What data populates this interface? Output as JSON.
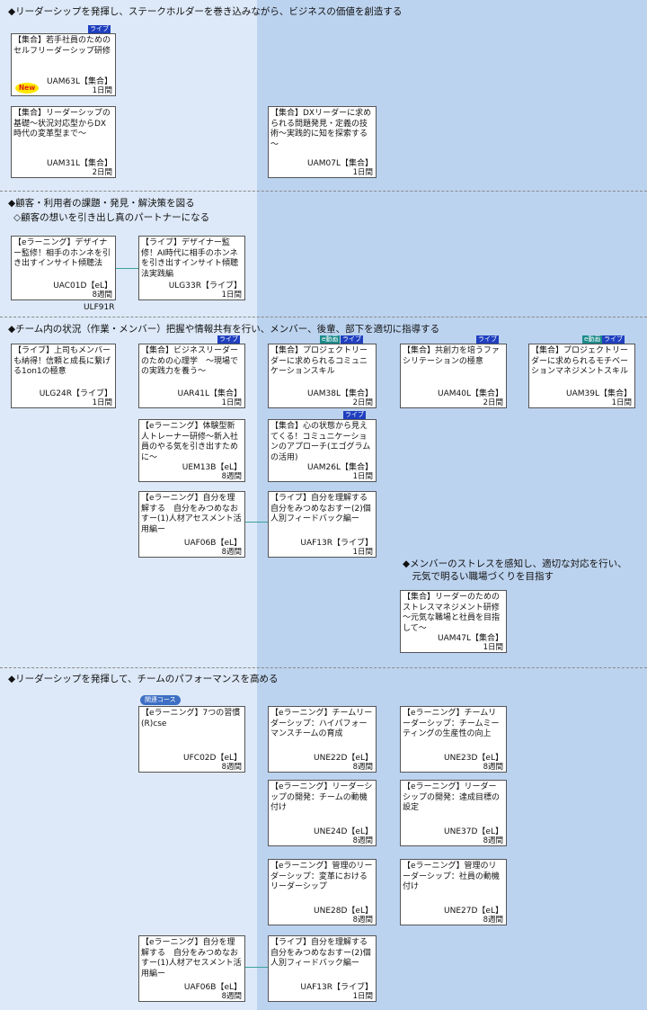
{
  "sections": {
    "s1": {
      "title": "◆リーダーシップを発揮し、ステークホルダーを巻き込みながら、ビジネスの価値を創造する"
    },
    "s2": {
      "title": "◆顧客・利用者の課題・発見・解決策を図る",
      "sub": "◇顧客の想いを引き出し真のパートナーになる"
    },
    "s3": {
      "title": "◆チーム内の状況（作業・メンバー）把握や情報共有を行い、メンバー、後輩、部下を適切に指導する",
      "sub": "◆メンバーのストレスを感知し、適切な対応を行い、\n　元気で明るい職場づくりを目指す"
    },
    "s4": {
      "title": "◆リーダーシップを発揮して、チームのパフォーマンスを高める"
    }
  },
  "badges": {
    "live": "ライブ",
    "video": "e動画",
    "related": "関連コース",
    "new": "New"
  },
  "stray_label": "ULF91R",
  "cards": [
    {
      "id": "c1",
      "title": "【集合】若手社員のための\nセルフリーダーシップ研修",
      "code": "UAM63L【集合】",
      "duration": "1日間"
    },
    {
      "id": "c2",
      "title": "【集合】リーダーシップの基礎～状況対応型からDX時代の変革型まで～",
      "code": "UAM31L【集合】",
      "duration": "2日間"
    },
    {
      "id": "c3",
      "title": "【集合】DXリーダーに求められる問題発見・定義の技術～実践的に知を探索する～",
      "code": "UAM07L【集合】",
      "duration": "1日間"
    },
    {
      "id": "c4",
      "title": "【eラーニング】デザイナー監修！相手のホンネを引き出すインサイト傾聴法",
      "code": "UAC01D【eL】",
      "duration": "8週間"
    },
    {
      "id": "c5",
      "title": "【ライブ】デザイナー監修！AI時代に相手のホンネを引き出すインサイト傾聴法実践編",
      "code": "ULG33R【ライブ】",
      "duration": "1日間"
    },
    {
      "id": "c6",
      "title": "【ライブ】上司もメンバーも納得！信頼と成長に繋げる1on1の極意",
      "code": "ULG24R【ライブ】",
      "duration": "1日間"
    },
    {
      "id": "c7",
      "title": "【集合】ビジネスリーダーのための心理学　～現場での実践力を養う～",
      "code": "UAR41L【集合】",
      "duration": "1日間"
    },
    {
      "id": "c8",
      "title": "【集合】プロジェクトリーダーに求められるコミュニケーションスキル",
      "code": "UAM38L【集合】",
      "duration": "2日間"
    },
    {
      "id": "c9",
      "title": "【集合】共創力を培うファシリテーションの極意",
      "code": "UAM40L【集合】",
      "duration": "2日間"
    },
    {
      "id": "c10",
      "title": "【集合】プロジェクトリーダーに求められるモチベーションマネジメントスキル",
      "code": "UAM39L【集合】",
      "duration": "1日間"
    },
    {
      "id": "c11",
      "title": "【eラーニング】体験型新人トレーナー研修～新入社員のやる気を引き出すために～",
      "code": "UEM13B【eL】",
      "duration": "8週間"
    },
    {
      "id": "c12",
      "title": "【集合】心の状態から見えてくる！コミュニケーションのアプローチ(エゴグラムの活用)",
      "code": "UAM26L【集合】",
      "duration": "1日間"
    },
    {
      "id": "c13",
      "title": "【eラーニング】自分を理解する　自分をみつめなおすー(1)人材アセスメント活用編ー",
      "code": "UAF06B【eL】",
      "duration": "8週間"
    },
    {
      "id": "c14",
      "title": "【ライブ】自分を理解する　自分をみつめなおすー(2)個人別フィードバック編ー",
      "code": "UAF13R【ライブ】",
      "duration": "1日間"
    },
    {
      "id": "c15",
      "title": "【集合】リーダーのためのストレスマネジメント研修～元気な職場と社員を目指して～",
      "code": "UAM47L【集合】",
      "duration": "1日間"
    },
    {
      "id": "c16",
      "title": "【eラーニング】7つの習慣(R)cse",
      "code": "UFC02D【eL】",
      "duration": "8週間"
    },
    {
      "id": "c17",
      "title": "【eラーニング】チームリーダーシップ：ハイパフォーマンスチームの育成",
      "code": "UNE22D【eL】",
      "duration": "8週間"
    },
    {
      "id": "c18",
      "title": "【eラーニング】チームリーダーシップ：チームミーティングの生産性の向上",
      "code": "UNE23D【eL】",
      "duration": "8週間"
    },
    {
      "id": "c19",
      "title": "【eラーニング】リーダーシップの開発：チームの動機付け",
      "code": "UNE24D【eL】",
      "duration": "8週間"
    },
    {
      "id": "c20",
      "title": "【eラーニング】リーダーシップの開発：達成目標の設定",
      "code": "UNE37D【eL】",
      "duration": "8週間"
    },
    {
      "id": "c21",
      "title": "【eラーニング】管理のリーダーシップ：変革におけるリーダーシップ",
      "code": "UNE28D【eL】",
      "duration": "8週間"
    },
    {
      "id": "c22",
      "title": "【eラーニング】管理のリーダーシップ：社員の動機付け",
      "code": "UNE27D【eL】",
      "duration": "8週間"
    },
    {
      "id": "c23",
      "title": "【eラーニング】自分を理解する　自分をみつめなおすー(1)人材アセスメント活用編ー",
      "code": "UAF06B【eL】",
      "duration": "8週間"
    },
    {
      "id": "c24",
      "title": "【ライブ】自分を理解する　自分をみつめなおすー(2)個人別フィードバック編ー",
      "code": "UAF13R【ライブ】",
      "duration": "1日間"
    }
  ]
}
